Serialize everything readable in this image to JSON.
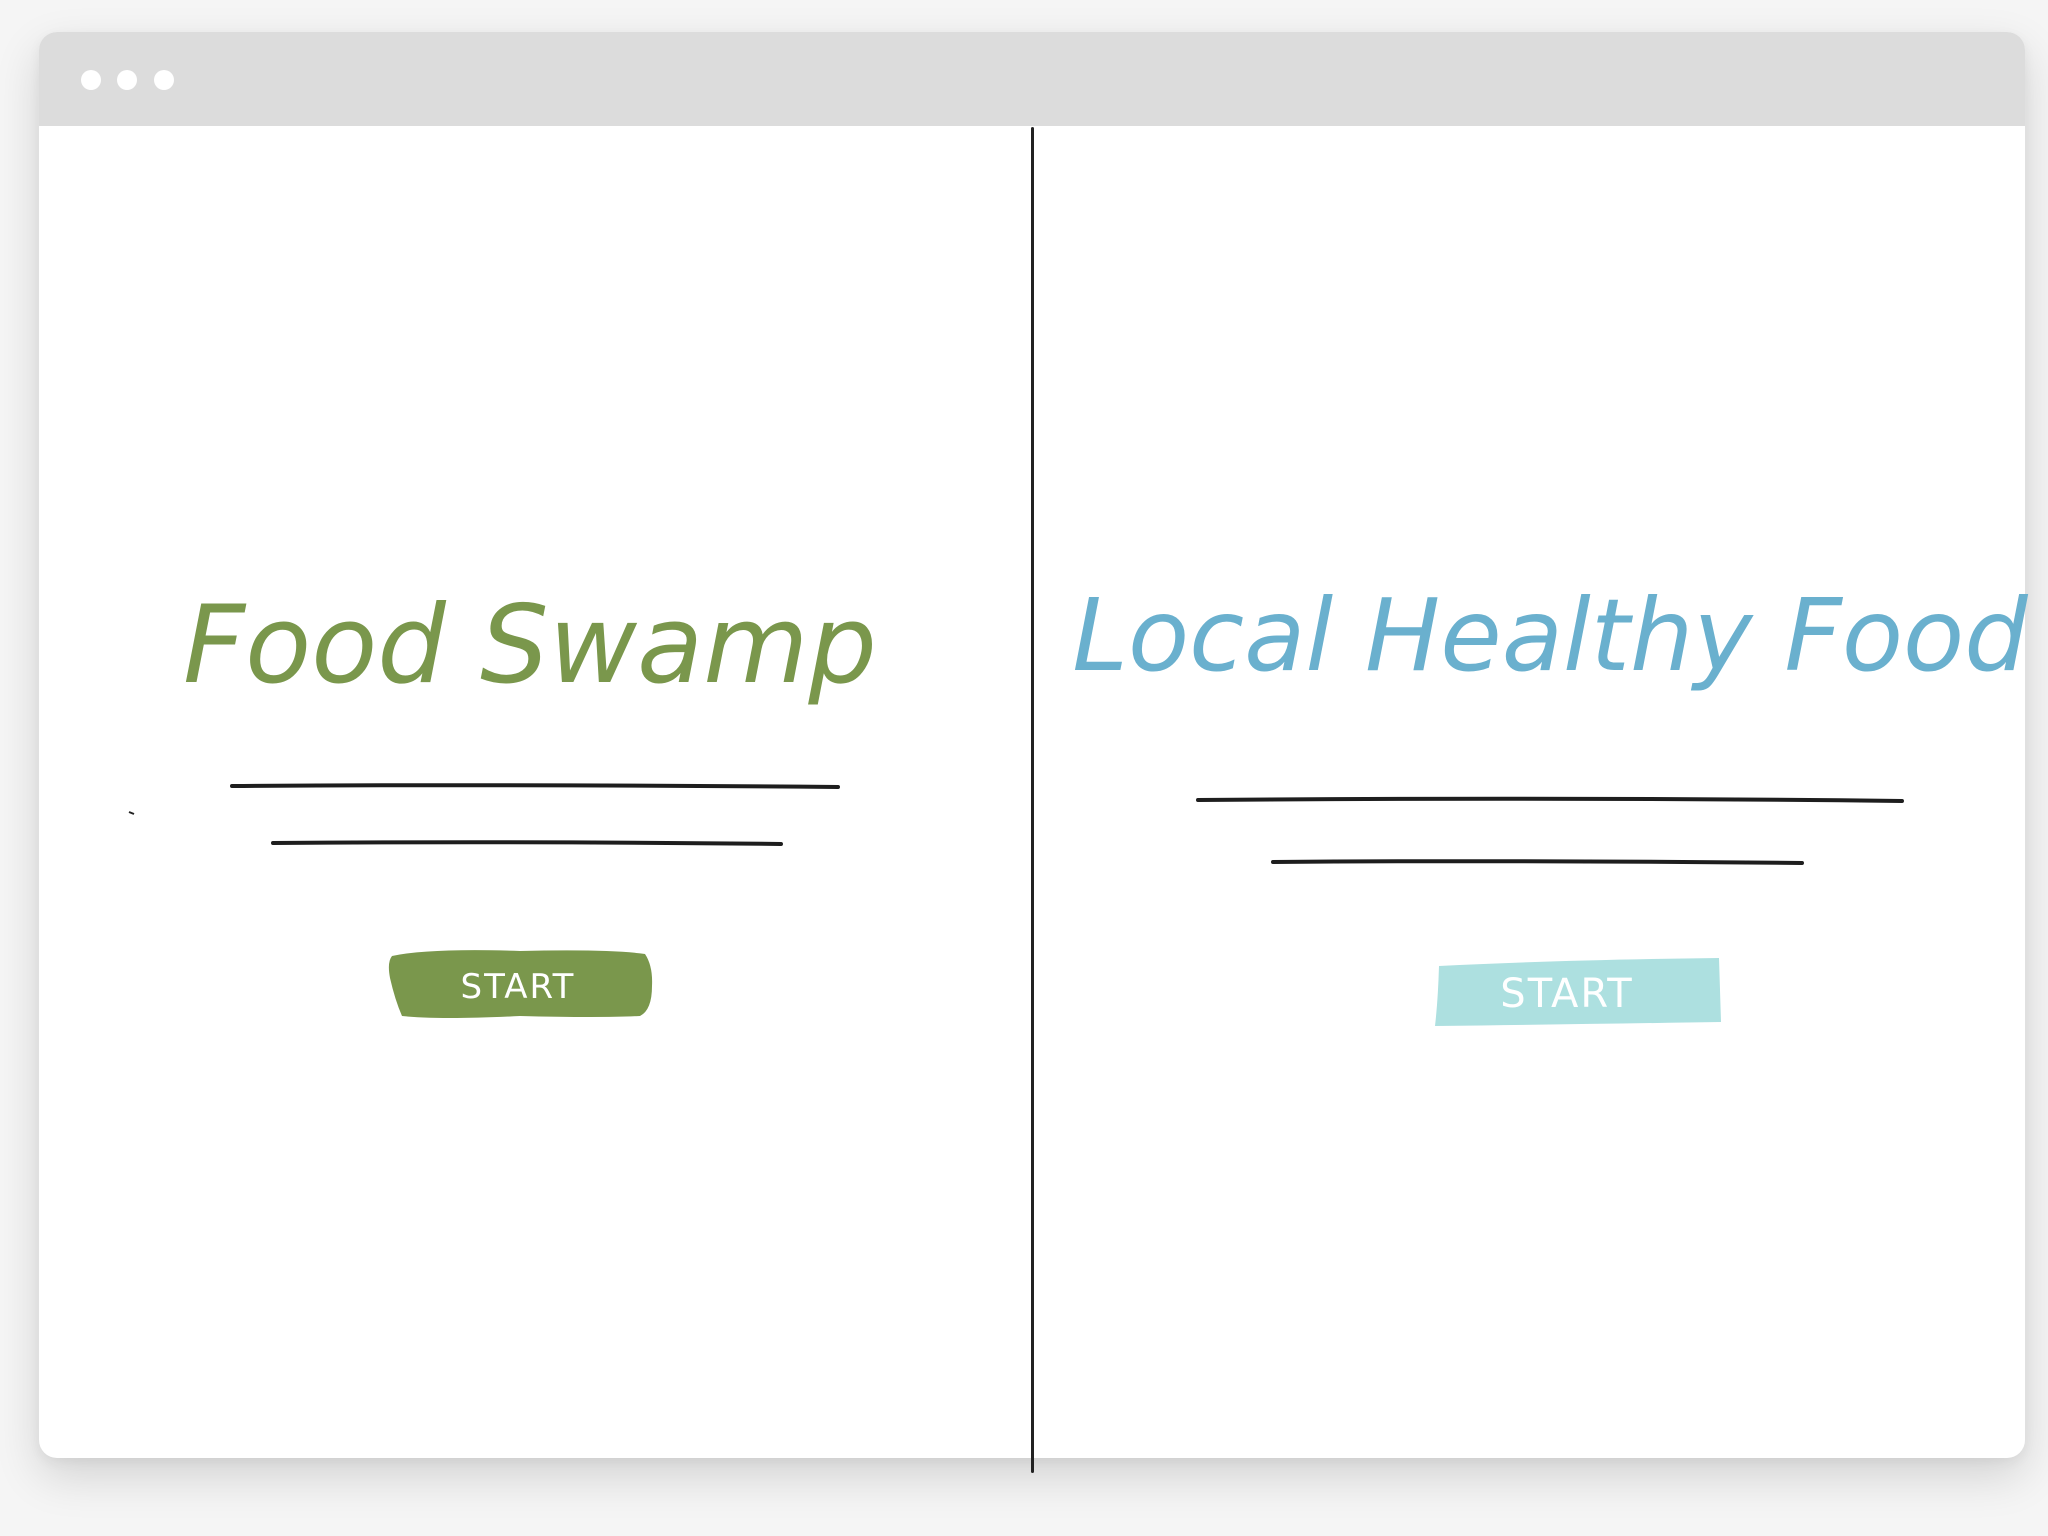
{
  "left_panel": {
    "title": "Food Swamp",
    "button_label": "START",
    "accent_color": "#7a974c"
  },
  "right_panel": {
    "title": "Local Healthy Food",
    "button_label": "START",
    "accent_color": "#6ab0ce",
    "button_color": "#ade0e0"
  }
}
